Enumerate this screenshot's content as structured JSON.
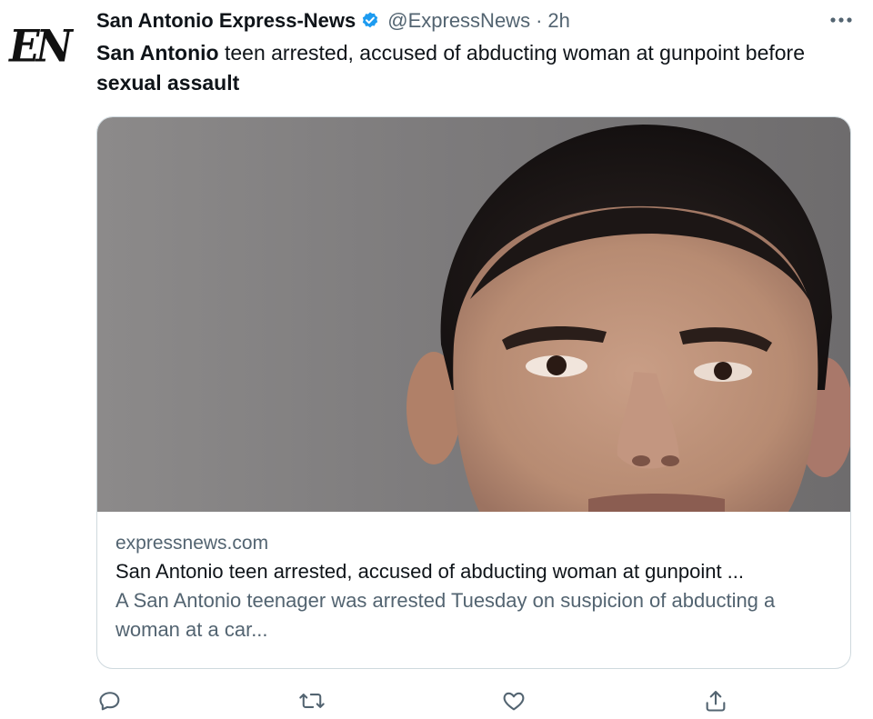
{
  "avatar": {
    "text": "EN"
  },
  "author": {
    "name": "San Antonio Express-News",
    "handle": "@ExpressNews",
    "separator": "·",
    "time": "2h",
    "verified": true
  },
  "tweet": {
    "part1_bold": "San Antonio",
    "part2": " teen arrested, accused of abducting woman at gunpoint before ",
    "part3_bold": "sexual assault"
  },
  "card": {
    "image_icon": "mugshot-photo",
    "domain": "expressnews.com",
    "title": "San Antonio teen arrested, accused of abducting woman at gunpoint ...",
    "description": "A San Antonio teenager was arrested Tuesday on suspicion of abducting a woman at a car..."
  },
  "actions": {
    "reply_icon": "reply-icon",
    "retweet_icon": "retweet-icon",
    "like_icon": "heart-icon",
    "share_icon": "share-icon"
  },
  "colors": {
    "text": "#0f1419",
    "muted": "#536471",
    "verified": "#1d9bf0",
    "border": "#cfd9de"
  }
}
